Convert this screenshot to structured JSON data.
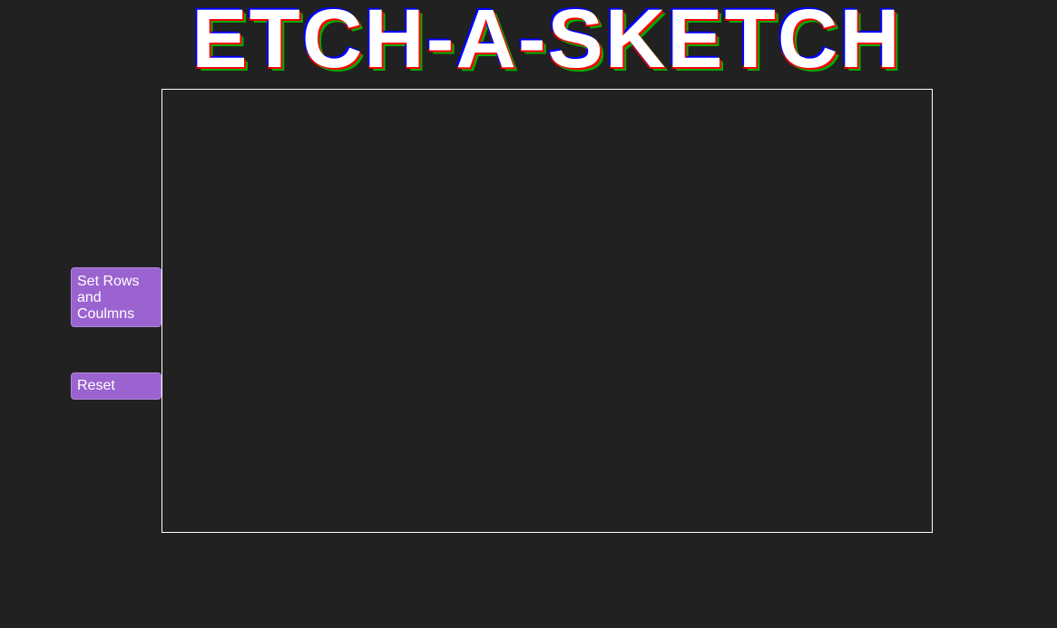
{
  "header": {
    "title": "ETCH-A-SKETCH"
  },
  "controls": {
    "set_grid_label": "Set Rows and Coulmns",
    "reset_label": "Reset"
  },
  "colors": {
    "background": "#212121",
    "button": "#9b63cf",
    "board_border": "#ffffff",
    "title_shadow_red": "#ff0000",
    "title_shadow_blue": "#0000ff",
    "title_shadow_green": "#00aa00"
  }
}
